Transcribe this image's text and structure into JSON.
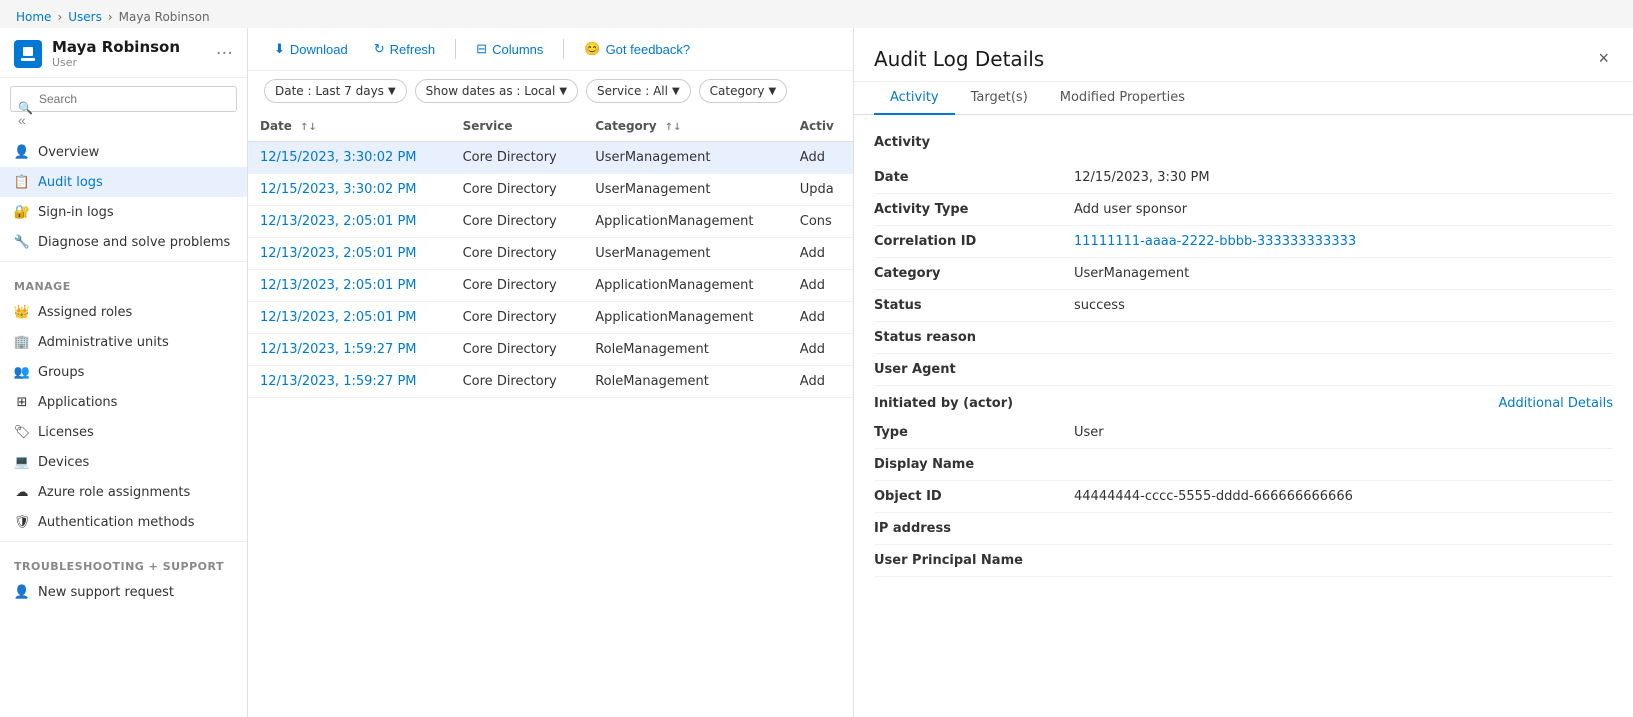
{
  "breadcrumb": {
    "items": [
      "Home",
      "Users",
      "Maya Robinson"
    ]
  },
  "sidebar": {
    "icon_label": "user-page-icon",
    "title": "Maya Robinson",
    "subtitle": "User",
    "more_icon": "···",
    "search_placeholder": "Search",
    "collapse_icon": "«",
    "nav_items": [
      {
        "id": "overview",
        "label": "Overview",
        "icon": "person-icon",
        "active": false
      },
      {
        "id": "audit-logs",
        "label": "Audit logs",
        "icon": "log-icon",
        "active": true
      },
      {
        "id": "sign-in-logs",
        "label": "Sign-in logs",
        "icon": "signin-icon",
        "active": false
      },
      {
        "id": "diagnose",
        "label": "Diagnose and solve problems",
        "icon": "tool-icon",
        "active": false
      }
    ],
    "manage_label": "Manage",
    "manage_items": [
      {
        "id": "assigned-roles",
        "label": "Assigned roles",
        "icon": "role-icon"
      },
      {
        "id": "admin-units",
        "label": "Administrative units",
        "icon": "admin-icon"
      },
      {
        "id": "groups",
        "label": "Groups",
        "icon": "group-icon"
      },
      {
        "id": "applications",
        "label": "Applications",
        "icon": "app-icon"
      },
      {
        "id": "licenses",
        "label": "Licenses",
        "icon": "license-icon"
      },
      {
        "id": "devices",
        "label": "Devices",
        "icon": "device-icon"
      },
      {
        "id": "azure-roles",
        "label": "Azure role assignments",
        "icon": "azure-icon"
      },
      {
        "id": "auth-methods",
        "label": "Authentication methods",
        "icon": "auth-icon"
      }
    ],
    "support_label": "Troubleshooting + Support",
    "support_items": [
      {
        "id": "new-support",
        "label": "New support request",
        "icon": "support-icon"
      }
    ]
  },
  "toolbar": {
    "download_label": "Download",
    "refresh_label": "Refresh",
    "columns_label": "Columns",
    "feedback_label": "Got feedback?"
  },
  "filters": {
    "date_filter": "Date : Last 7 days",
    "show_dates_filter": "Show dates as : Local",
    "service_filter": "Service : All",
    "category_filter": "Category"
  },
  "table": {
    "columns": [
      "Date",
      "Service",
      "Category",
      "Activ"
    ],
    "rows": [
      {
        "date": "12/15/2023, 3:30:02 PM",
        "service": "Core Directory",
        "category": "UserManagement",
        "activity": "Add"
      },
      {
        "date": "12/15/2023, 3:30:02 PM",
        "service": "Core Directory",
        "category": "UserManagement",
        "activity": "Upda"
      },
      {
        "date": "12/13/2023, 2:05:01 PM",
        "service": "Core Directory",
        "category": "ApplicationManagement",
        "activity": "Cons"
      },
      {
        "date": "12/13/2023, 2:05:01 PM",
        "service": "Core Directory",
        "category": "UserManagement",
        "activity": "Add"
      },
      {
        "date": "12/13/2023, 2:05:01 PM",
        "service": "Core Directory",
        "category": "ApplicationManagement",
        "activity": "Add"
      },
      {
        "date": "12/13/2023, 2:05:01 PM",
        "service": "Core Directory",
        "category": "ApplicationManagement",
        "activity": "Add"
      },
      {
        "date": "12/13/2023, 1:59:27 PM",
        "service": "Core Directory",
        "category": "RoleManagement",
        "activity": "Add"
      },
      {
        "date": "12/13/2023, 1:59:27 PM",
        "service": "Core Directory",
        "category": "RoleManagement",
        "activity": "Add"
      }
    ]
  },
  "detail": {
    "title": "Audit Log Details",
    "close_icon": "×",
    "tabs": [
      "Activity",
      "Target(s)",
      "Modified Properties"
    ],
    "active_tab": "Activity",
    "section_title": "Activity",
    "fields": [
      {
        "label": "Date",
        "value": "12/15/2023, 3:30 PM"
      },
      {
        "label": "Activity Type",
        "value": "Add user sponsor"
      },
      {
        "label": "Correlation ID",
        "value": "11111111-aaaa-2222-bbbb-333333333333",
        "link": true
      },
      {
        "label": "Category",
        "value": "UserManagement"
      },
      {
        "label": "Status",
        "value": "success"
      },
      {
        "label": "Status reason",
        "value": ""
      },
      {
        "label": "User Agent",
        "value": ""
      }
    ],
    "initiated_by_label": "Initiated by (actor)",
    "additional_details_label": "Additional Details",
    "actor_fields": [
      {
        "label": "Type",
        "value": "User"
      },
      {
        "label": "Display Name",
        "value": ""
      },
      {
        "label": "Object ID",
        "value": "44444444-cccc-5555-dddd-666666666666"
      },
      {
        "label": "IP address",
        "value": ""
      },
      {
        "label": "User Principal Name",
        "value": ""
      }
    ]
  }
}
